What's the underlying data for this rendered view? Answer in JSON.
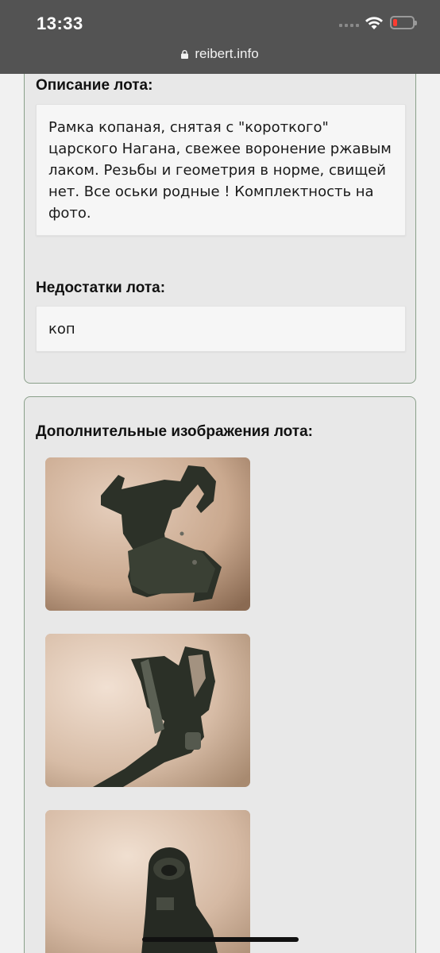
{
  "status_bar": {
    "time": "13:33",
    "icons": [
      "signal-icon",
      "wifi-icon",
      "battery-low-icon"
    ],
    "battery_color": "#ff3b30"
  },
  "url_bar": {
    "domain": "reibert.info",
    "icon": "lock-icon"
  },
  "lot": {
    "description_title": "Описание лота:",
    "description_text": "Рамка копаная, снятая с \"короткого\" царского Нагана, свежее воронение ржавым лаком. Резьбы и геометрия в норме, свищей нет. Все оськи родные ! Комплектность на фото.",
    "defects_title": "Недостатки лота:",
    "defects_text": "коп",
    "images_title": "Дополнительные изображения лота:",
    "images": [
      "lot-image-1",
      "lot-image-2",
      "lot-image-3"
    ]
  },
  "colors": {
    "panel_border": "#8aa08a",
    "topbar_bg": "#535353"
  }
}
